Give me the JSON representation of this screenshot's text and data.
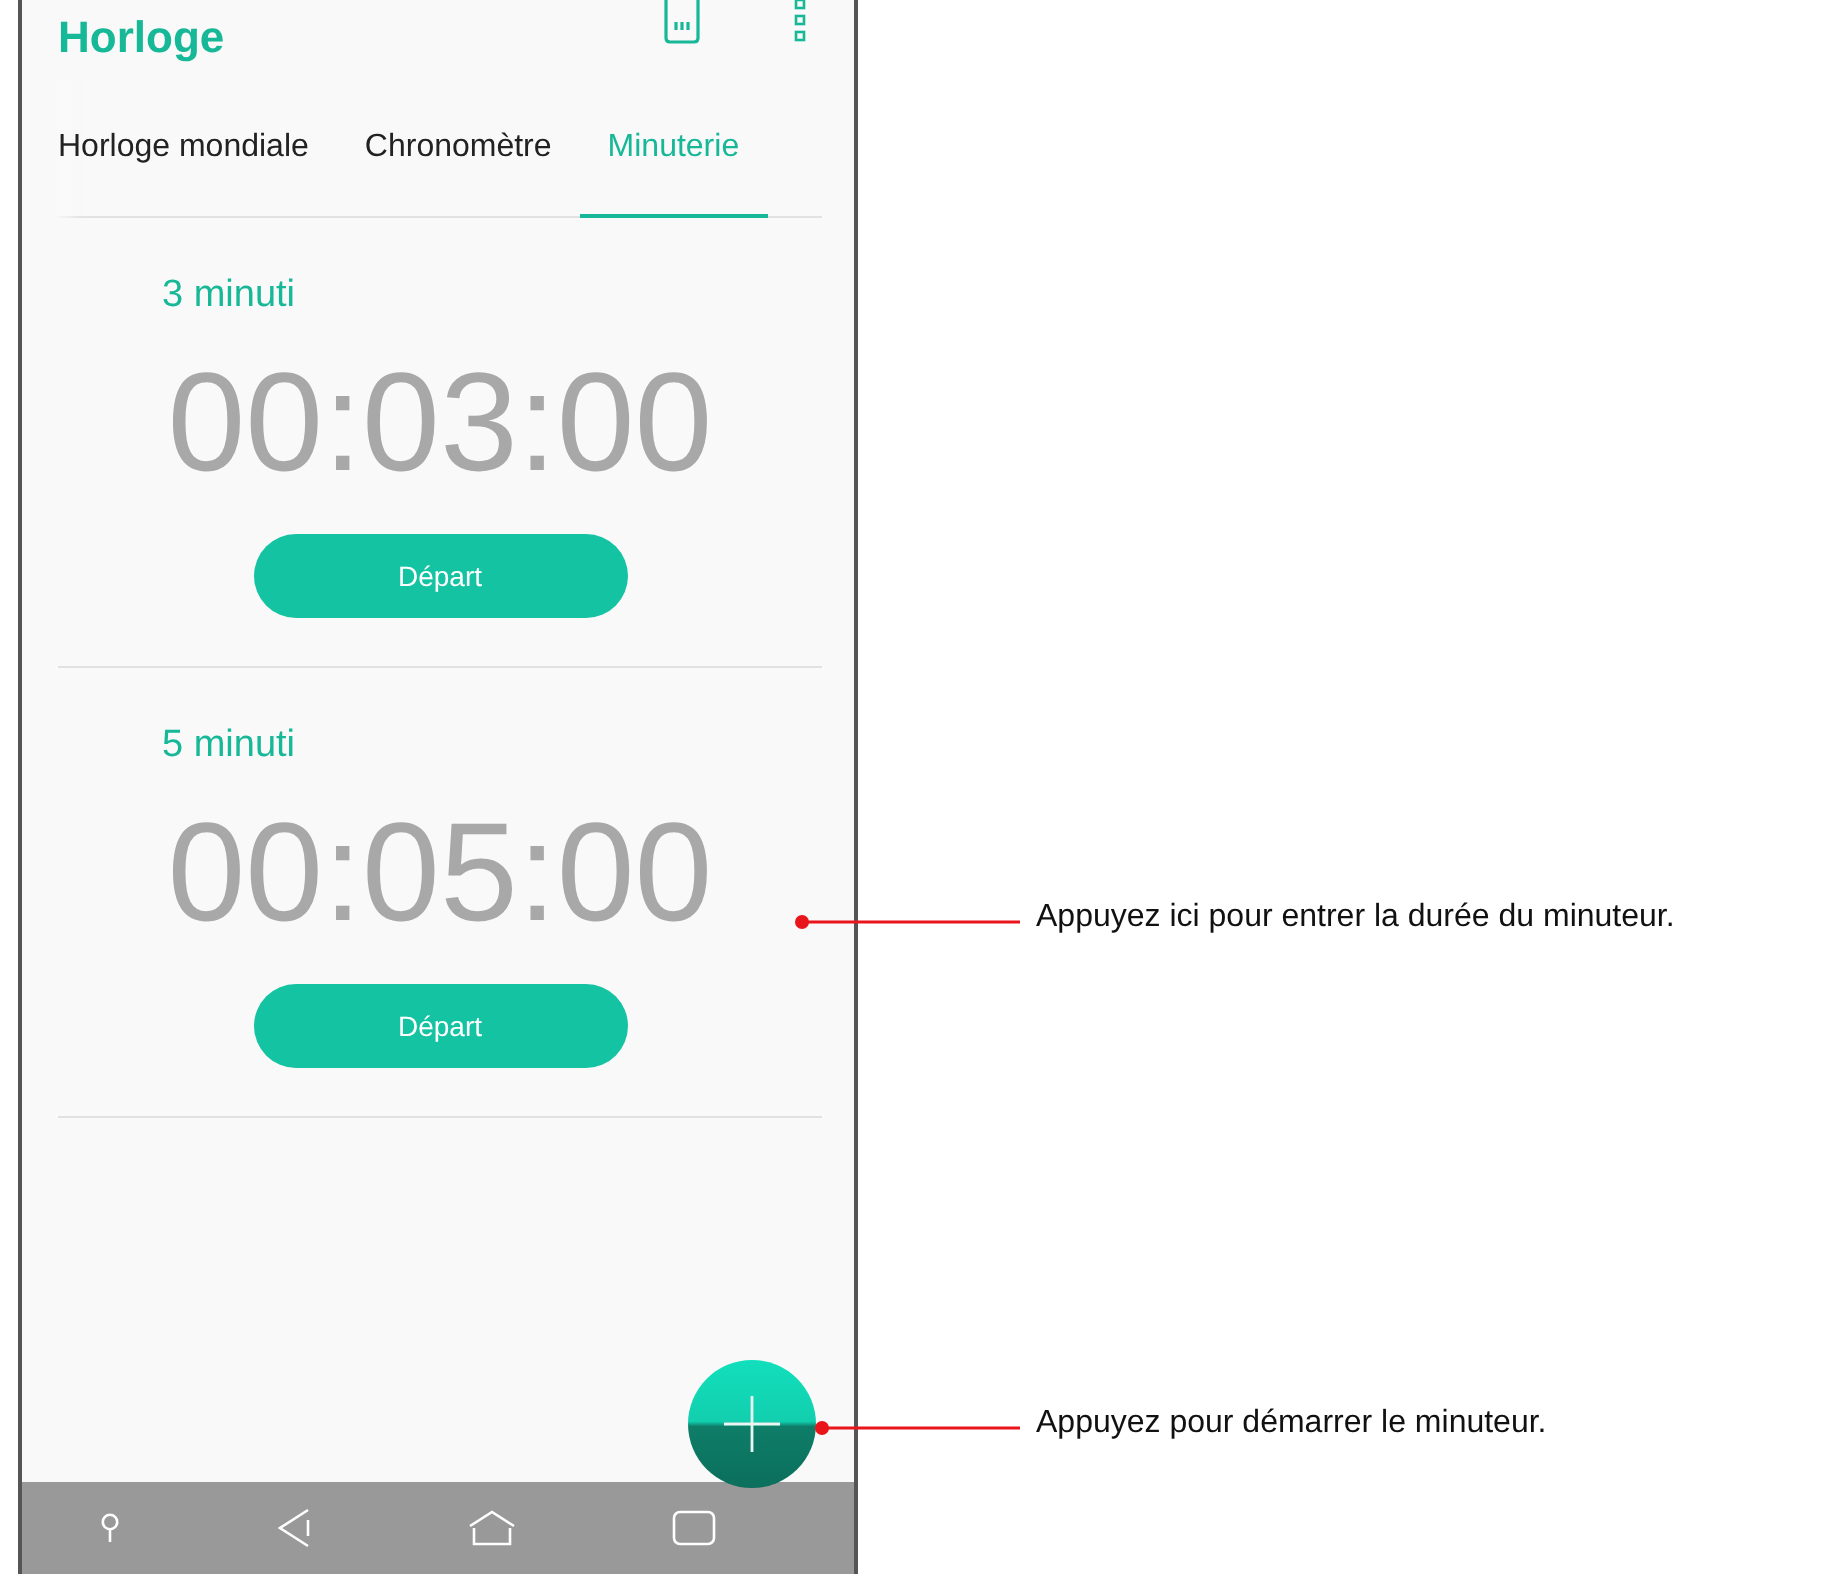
{
  "app": {
    "title": "Horloge"
  },
  "tabs": [
    {
      "label": "Horloge mondiale",
      "selected": false
    },
    {
      "label": "Chronomètre",
      "selected": false
    },
    {
      "label": "Minuterie",
      "selected": true
    }
  ],
  "timers": [
    {
      "label": "3 minuti",
      "time": "00:03:00",
      "button": "Départ"
    },
    {
      "label": "5 minuti",
      "time": "00:05:00",
      "button": "Départ"
    }
  ],
  "annotations": [
    {
      "kind": "timer",
      "text": "Appuyez ici pour entrer la durée du minuteur."
    },
    {
      "kind": "add",
      "text": "Appuyez pour démarrer le minuteur."
    }
  ]
}
